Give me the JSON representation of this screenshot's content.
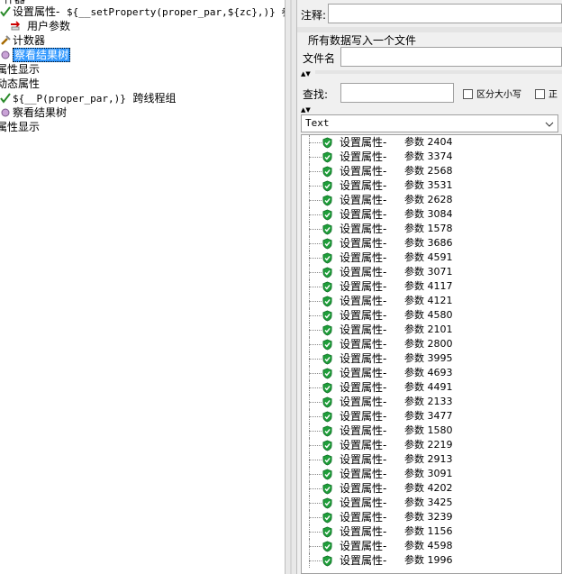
{
  "left_tree": {
    "top_partial": "什器",
    "items": [
      {
        "label": "设置属性-",
        "expr": "${__setProperty(proper_par,${zc},)} 参数",
        "icon": "check-icon"
      },
      {
        "label": "用户参数",
        "icon": "pencil-icon"
      },
      {
        "label": "计数器",
        "icon": "tool-icon"
      },
      {
        "label": "察看结果树",
        "icon": "listener-icon",
        "selected": true
      },
      {
        "label": "属性显示"
      },
      {
        "label": "动态属性"
      },
      {
        "expr": "${__P(proper_par,)}",
        "label": "跨线程组",
        "icon": "check-icon"
      },
      {
        "label": "察看结果树",
        "icon": "listener-icon"
      },
      {
        "label": "属性显示"
      }
    ]
  },
  "right_panel": {
    "comment_label": "注释:",
    "write_all_label": "所有数据写入一个文件",
    "filename_label": "文件名",
    "search_label": "查找:",
    "case_sensitive_label": "区分大小写",
    "regex_label_partial": "正",
    "renderer_selected": "Text",
    "result_prefix": "设置属性-",
    "result_param": "参数",
    "result_numbers": [
      "2404",
      "3374",
      "2568",
      "3531",
      "2628",
      "3084",
      "1578",
      "3686",
      "4591",
      "3071",
      "4117",
      "4121",
      "4580",
      "2101",
      "2800",
      "3995",
      "4693",
      "4491",
      "2133",
      "3477",
      "1580",
      "2219",
      "2913",
      "3091",
      "4202",
      "3425",
      "3239",
      "1156",
      "4598",
      "1996"
    ]
  }
}
